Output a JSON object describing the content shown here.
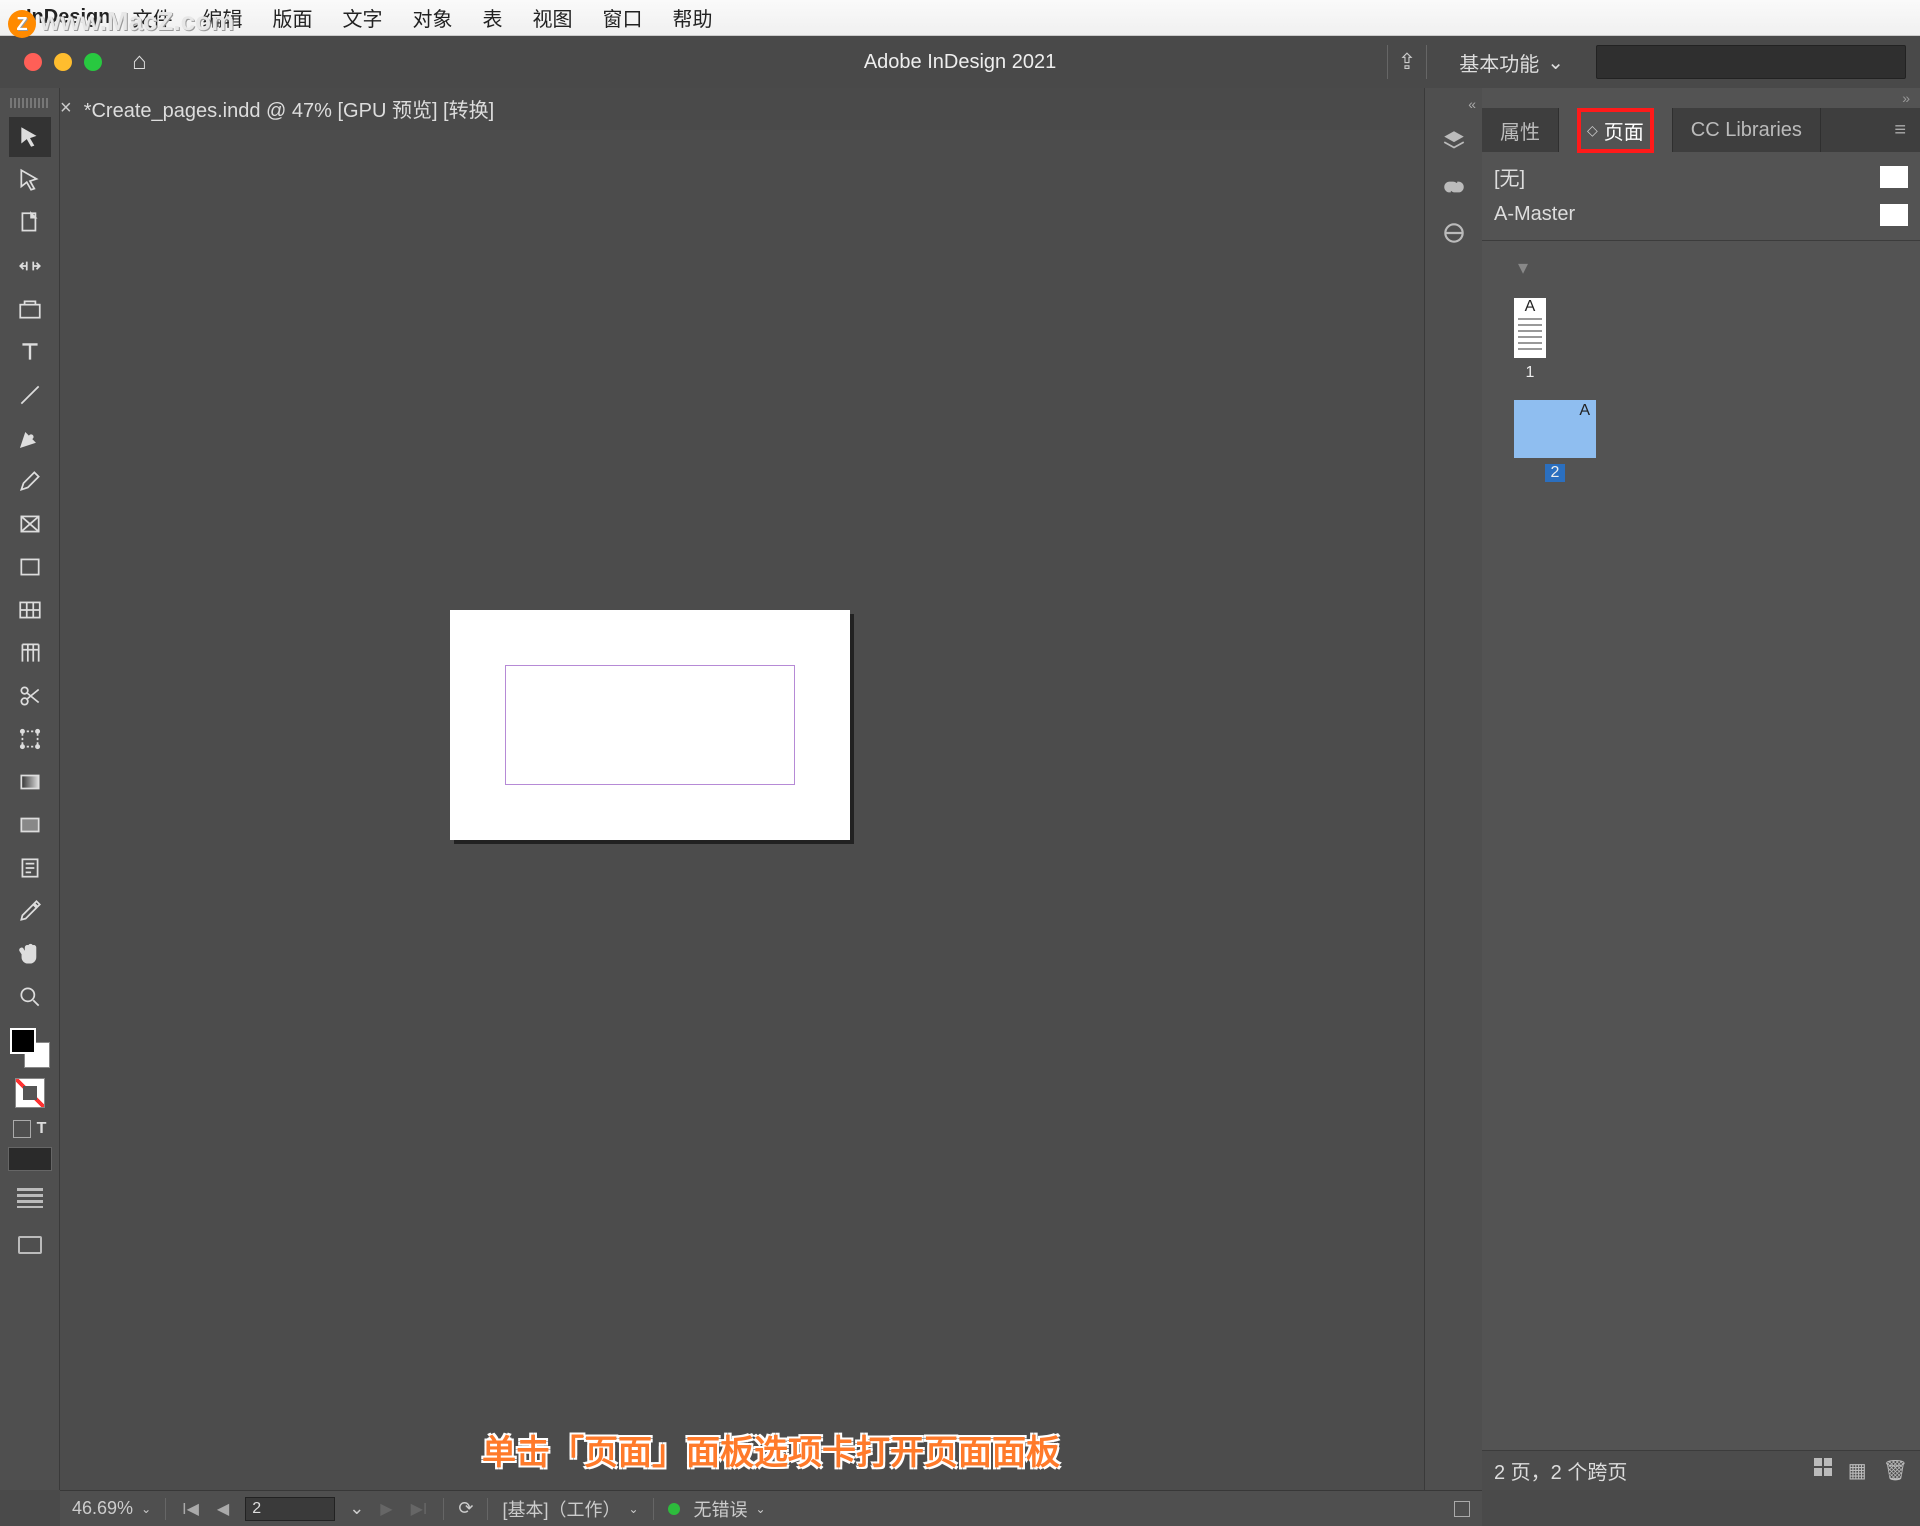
{
  "mac_menu": {
    "app_name": "InDesign",
    "items": [
      "文件",
      "编辑",
      "版面",
      "文字",
      "对象",
      "表",
      "视图",
      "窗口",
      "帮助"
    ]
  },
  "watermark": "www.MacZ.com",
  "app_bar": {
    "title": "Adobe InDesign 2021",
    "workspace": "基本功能"
  },
  "doc_tab": "*Create_pages.indd @ 47% [GPU 预览] [转换]",
  "right_panel": {
    "tabs": {
      "properties": "属性",
      "pages": "页面",
      "cclib": "CC Libraries"
    },
    "masters": {
      "none": "[无]",
      "a": "A-Master"
    },
    "page1_letter": "A",
    "page1_num": "1",
    "page2_letter": "A",
    "page2_num": "2",
    "footer_status": "2 页，2 个跨页"
  },
  "status": {
    "zoom": "46.69%",
    "page": "2",
    "profile": "[基本]（工作）",
    "errors": "无错误"
  },
  "instruction": "单击「页面」面板选项卡打开页面面板"
}
